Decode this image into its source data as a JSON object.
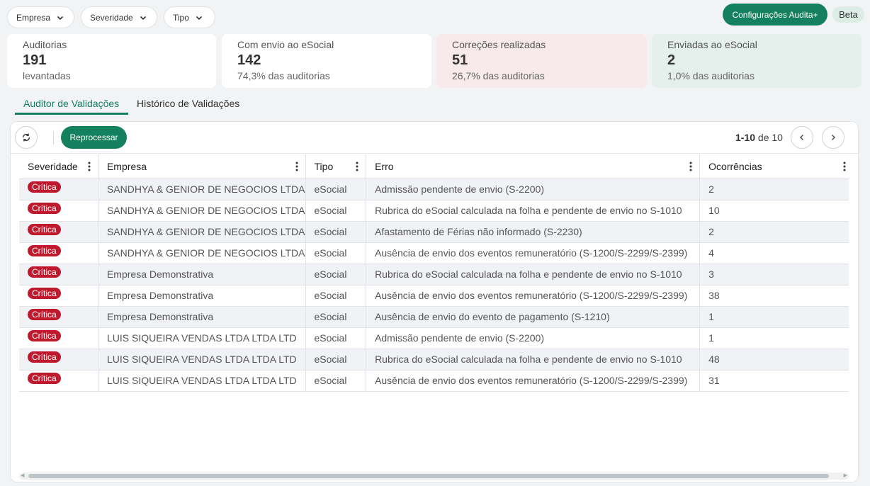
{
  "filters": [
    {
      "label": "Empresa"
    },
    {
      "label": "Severidade"
    },
    {
      "label": "Tipo"
    }
  ],
  "header": {
    "config_button": "Configurações Audita+",
    "beta_badge": "Beta"
  },
  "stats": [
    {
      "label": "Auditorias",
      "value": "191",
      "sub": "levantadas"
    },
    {
      "label": "Com envio ao eSocial",
      "value": "142",
      "sub": "74,3% das auditorias"
    },
    {
      "label": "Correções realizadas",
      "value": "51",
      "sub": "26,7% das auditorias"
    },
    {
      "label": "Enviadas ao eSocial",
      "value": "2",
      "sub": "1,0% das auditorias"
    }
  ],
  "tabs": [
    {
      "label": "Auditor de Validações",
      "active": true
    },
    {
      "label": "Histórico de Validações",
      "active": false
    }
  ],
  "toolbar": {
    "reprocess_label": "Reprocessar",
    "pager_range": "1-10",
    "pager_of": "de 10"
  },
  "table": {
    "columns": [
      "Severidade",
      "Empresa",
      "Tipo",
      "Erro",
      "Ocorrências"
    ],
    "rows": [
      {
        "severity": "Crítica",
        "company": "SANDHYA & GENIOR DE NEGOCIOS LTDA",
        "type": "eSocial",
        "error": "Admissão pendente de envio (S-2200)",
        "count": "2"
      },
      {
        "severity": "Crítica",
        "company": "SANDHYA & GENIOR DE NEGOCIOS LTDA",
        "type": "eSocial",
        "error": "Rubrica do eSocial calculada na folha e pendente de envio no S-1010",
        "count": "10"
      },
      {
        "severity": "Crítica",
        "company": "SANDHYA & GENIOR DE NEGOCIOS LTDA",
        "type": "eSocial",
        "error": "Afastamento de Férias não informado (S-2230)",
        "count": "2"
      },
      {
        "severity": "Crítica",
        "company": "SANDHYA & GENIOR DE NEGOCIOS LTDA",
        "type": "eSocial",
        "error": "Ausência de envio dos eventos remuneratório (S-1200/S-2299/S-2399)",
        "count": "4"
      },
      {
        "severity": "Crítica",
        "company": "Empresa Demonstrativa",
        "type": "eSocial",
        "error": "Rubrica do eSocial calculada na folha e pendente de envio no S-1010",
        "count": "3"
      },
      {
        "severity": "Crítica",
        "company": "Empresa Demonstrativa",
        "type": "eSocial",
        "error": "Ausência de envio dos eventos remuneratório (S-1200/S-2299/S-2399)",
        "count": "38"
      },
      {
        "severity": "Crítica",
        "company": "Empresa Demonstrativa",
        "type": "eSocial",
        "error": "Ausência de envio do evento de pagamento (S-1210)",
        "count": "1"
      },
      {
        "severity": "Crítica",
        "company": "LUIS SIQUEIRA VENDAS LTDA LTDA LTD",
        "type": "eSocial",
        "error": "Admissão pendente de envio (S-2200)",
        "count": "1"
      },
      {
        "severity": "Crítica",
        "company": "LUIS SIQUEIRA VENDAS LTDA LTDA LTD",
        "type": "eSocial",
        "error": "Rubrica do eSocial calculada na folha e pendente de envio no S-1010",
        "count": "48"
      },
      {
        "severity": "Crítica",
        "company": "LUIS SIQUEIRA VENDAS LTDA LTDA LTD",
        "type": "eSocial",
        "error": "Ausência de envio dos eventos remuneratório (S-1200/S-2299/S-2399)",
        "count": "31"
      }
    ]
  },
  "colors": {
    "accent": "#15805e",
    "critical": "#c0182d",
    "card_pink": "#f8e9ea",
    "card_green": "#e5f0ec"
  },
  "icons": [
    "chevron-down-icon",
    "refresh-icon",
    "chevron-left-icon",
    "chevron-right-icon",
    "more-vert-icon"
  ]
}
